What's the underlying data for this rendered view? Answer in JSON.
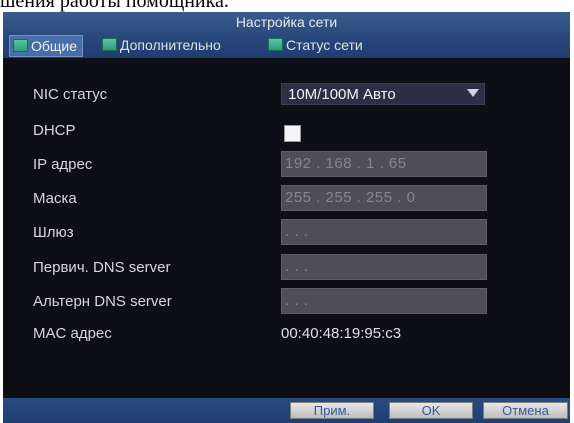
{
  "page_fragment": "шения работы помощника.",
  "window": {
    "title": "Настройка сети"
  },
  "tabs": [
    {
      "label": "Общие",
      "active": true,
      "icon": "network-tab-icon"
    },
    {
      "label": "Дополнительно",
      "active": false,
      "icon": "network-tab-icon"
    },
    {
      "label": "Статус сети",
      "active": false,
      "icon": "network-tab-icon"
    }
  ],
  "form": {
    "nic_status": {
      "label": "NIC статус",
      "value": "10M/100M Авто"
    },
    "dhcp": {
      "label": "DHCP",
      "checked": false
    },
    "ip": {
      "label": "IP адрес",
      "value": "192 . 168 . 1     . 65"
    },
    "mask": {
      "label": "Маска",
      "value": "255 . 255 . 255 . 0"
    },
    "gateway": {
      "label": "Шлюз",
      "value": ".   .   ."
    },
    "dns1": {
      "label": "Первич. DNS server",
      "value": ".   .   ."
    },
    "dns2": {
      "label": "Альтерн DNS server",
      "value": ".   .   ."
    },
    "mac": {
      "label": "MAC адрес",
      "value": "00:40:48:19:95:c3"
    }
  },
  "buttons": {
    "apply": "Прим.",
    "ok": "OK",
    "cancel": "Отмена"
  },
  "colors": {
    "titlebar": "#2c4d7e",
    "panel": "#0e0e16",
    "field": "#4e4e54",
    "accent": "#466ea8"
  }
}
